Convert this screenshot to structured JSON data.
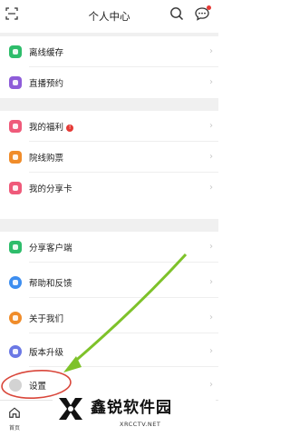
{
  "header": {
    "title": "个人中心"
  },
  "group1": [
    {
      "label": "离线缓存",
      "color": "#2ebd6b",
      "icon": "download-icon"
    },
    {
      "label": "直播预约",
      "color": "#8e5cd9",
      "icon": "live-icon"
    }
  ],
  "group2": [
    {
      "label": "我的福利",
      "color": "#ef5a7a",
      "icon": "gift-icon",
      "badge": "!"
    },
    {
      "label": "院线购票",
      "color": "#f08c2a",
      "icon": "ticket-icon"
    },
    {
      "label": "我的分享卡",
      "color": "#ef5a7a",
      "icon": "share-card-icon"
    }
  ],
  "group3": [
    {
      "label": "分享客户端",
      "color": "#2ebd6b",
      "icon": "share-icon"
    },
    {
      "label": "帮助和反馈",
      "color": "#3d8ef0",
      "icon": "help-icon"
    },
    {
      "label": "关于我们",
      "color": "#f08c2a",
      "icon": "info-icon"
    },
    {
      "label": "版本升级",
      "color": "#6b78e5",
      "icon": "upgrade-icon"
    },
    {
      "label": "设置",
      "color": "#d3d3d3",
      "icon": "gear-icon"
    }
  ],
  "tabbar": {
    "home_label": "首页"
  },
  "watermark": {
    "name": "鑫锐软件园",
    "url": "XRCCTV.NET"
  },
  "annotation_colors": {
    "circle": "#d9463a",
    "arrow": "#7ec22a"
  }
}
